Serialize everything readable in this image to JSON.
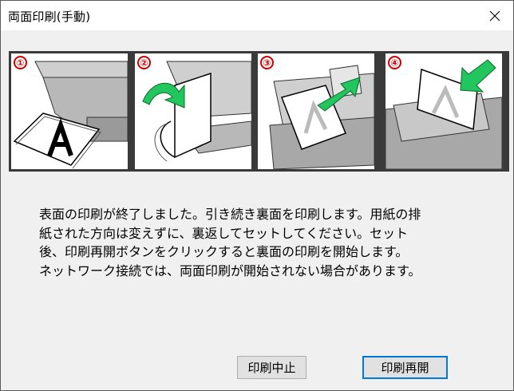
{
  "window": {
    "title": "両面印刷(手動)"
  },
  "steps": [
    {
      "number": "①"
    },
    {
      "number": "②"
    },
    {
      "number": "③"
    },
    {
      "number": "④"
    }
  ],
  "message": "表面の印刷が終了しました。引き続き裏面を印刷します。用紙の排\n紙された方向は変えずに、裏返してセットしてください。セット\n後、印刷再開ボタンをクリックすると裏面の印刷を開始します。\nネットワーク接続では、両面印刷が開始されない場合があります。",
  "buttons": {
    "cancel": "印刷中止",
    "resume": "印刷再開"
  },
  "colors": {
    "arrow": "#22c55e",
    "step_number": "#d00000",
    "default_button_border": "#0078d7"
  }
}
